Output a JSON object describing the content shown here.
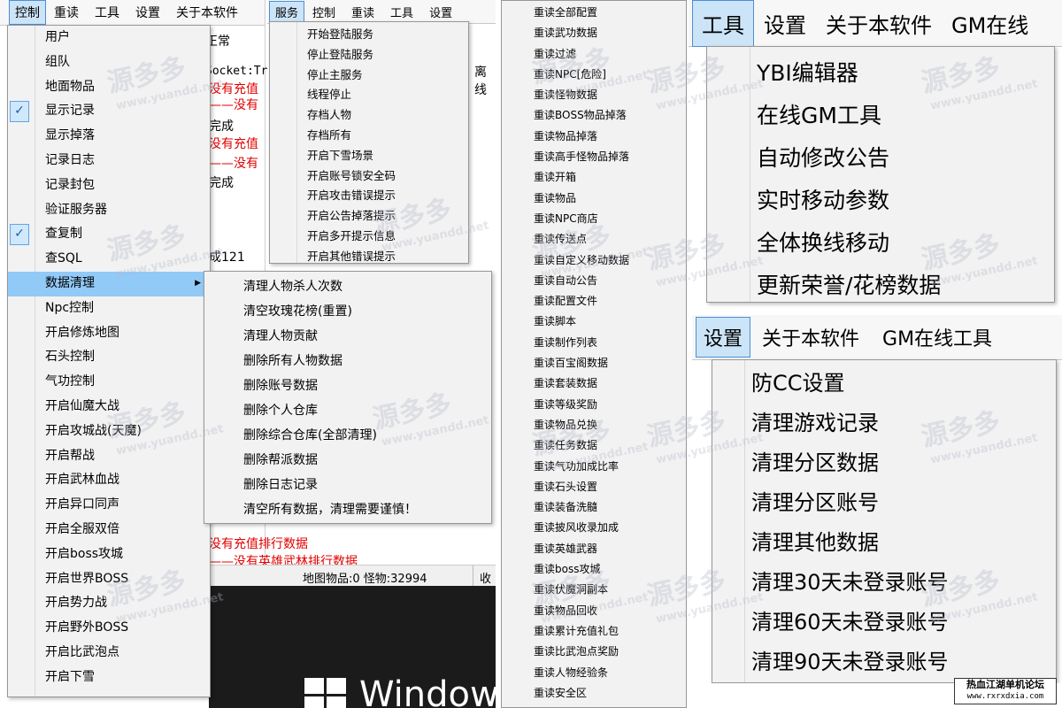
{
  "panel1": {
    "menubar": [
      "控制",
      "重读",
      "工具",
      "设置",
      "关于本软件"
    ],
    "bg_texts": {
      "t1": "正常",
      "t2": "Socket:Tr",
      "t3": "没有充值",
      "t4": "——没有",
      "t5": "完成",
      "t6": "没有充值",
      "t7": "——没有",
      "t8": "完成",
      "t9": "成121",
      "t10": "没有充值排行数据",
      "t11": "——没有英雄武林排行数据",
      "t12": "离线",
      "t13": "收",
      "t14": "Window",
      "status": "地图物品:0  怪物:32994"
    },
    "control_menu": [
      {
        "label": "用户"
      },
      {
        "label": "组队"
      },
      {
        "label": "地面物品"
      },
      {
        "label": "显示记录",
        "checked": true
      },
      {
        "label": "显示掉落"
      },
      {
        "label": "记录日志"
      },
      {
        "label": "记录封包"
      },
      {
        "label": "验证服务器"
      },
      {
        "label": "查复制",
        "checked": true
      },
      {
        "label": "查SQL"
      },
      {
        "label": "数据清理",
        "submenu": true,
        "highlighted": true
      },
      {
        "label": "Npc控制"
      },
      {
        "label": "开启修炼地图"
      },
      {
        "label": "石头控制"
      },
      {
        "label": "气功控制"
      },
      {
        "label": "开启仙魔大战"
      },
      {
        "label": "开启攻城战(天魔)"
      },
      {
        "label": "开启帮战"
      },
      {
        "label": "开启武林血战"
      },
      {
        "label": "开启异口同声"
      },
      {
        "label": "开启全服双倍"
      },
      {
        "label": "开启boss攻城"
      },
      {
        "label": "开启世界BOSS"
      },
      {
        "label": "开启势力战"
      },
      {
        "label": "开启野外BOSS"
      },
      {
        "label": "开启比武泡点"
      },
      {
        "label": "开启下雪"
      }
    ],
    "submenu": [
      "清理人物杀人次数",
      "清空玫瑰花榜(重置)",
      "清理人物贡献",
      "删除所有人物数据",
      "删除账号数据",
      "删除个人仓库",
      "删除综合仓库(全部清理)",
      "删除帮派数据",
      "删除日志记录",
      "清空所有数据，清理需要谨慎！"
    ]
  },
  "panel2": {
    "menubar": [
      "服务",
      "控制",
      "重读",
      "工具",
      "设置"
    ],
    "menu": [
      "开始登陆服务",
      "停止登陆服务",
      "停止主服务",
      "线程停止",
      "存档人物",
      "存档所有",
      "开启下雪场景",
      "开启账号锁安全码",
      "开启攻击错误提示",
      "开启公告掉落提示",
      "开启多开提示信息",
      "开启其他错误提示"
    ]
  },
  "panel3": {
    "menu": [
      "重读全部配置",
      "重读武功数据",
      "重读过滤",
      "重读NPC[危险]",
      "重读怪物数据",
      "重读BOSS物品掉落",
      "重读物品掉落",
      "重读高手怪物品掉落",
      "重读开箱",
      "重读物品",
      "重读NPC商店",
      "重读传送点",
      "重读自定义移动数据",
      "重读自动公告",
      "重读配置文件",
      "重读脚本",
      "重读制作列表",
      "重读百宝阁数据",
      "重读套装数据",
      "重读等级奖励",
      "重读物品兑换",
      "重读任务数据",
      "重读气功加成比率",
      "重读石头设置",
      "重读装备洗髓",
      "重读披风收录加成",
      "重读英雄武器",
      "重读boss攻城",
      "重读伏魔洞副本",
      "重读物品回收",
      "重读累计充值礼包",
      "重读比武泡点奖励",
      "重读人物经验条",
      "重读安全区"
    ]
  },
  "panel4": {
    "menubar": [
      "工具",
      "设置",
      "关于本软件",
      "GM在线"
    ],
    "menu": [
      "YBI编辑器",
      "在线GM工具",
      "自动修改公告",
      "实时移动参数",
      "全体换线移动",
      "更新荣誉/花榜数据"
    ]
  },
  "panel5": {
    "menubar": [
      "设置",
      "关于本软件",
      "GM在线工具"
    ],
    "menu": [
      "防CC设置",
      "清理游戏记录",
      "清理分区数据",
      "清理分区账号",
      "清理其他数据",
      "清理30天未登录账号",
      "清理60天未登录账号",
      "清理90天未登录账号"
    ]
  },
  "watermark": {
    "brand": "源多多",
    "url": "www.yuandd.net"
  },
  "footer_logo": {
    "line1": "热血江湖单机论坛",
    "line2": "www.rxrxdxia.com"
  },
  "colors": {
    "highlight": "#91c9f7",
    "menubar_active": "#cce4f7",
    "red": "#e30000",
    "menu_bg": "#f2f2f2"
  }
}
